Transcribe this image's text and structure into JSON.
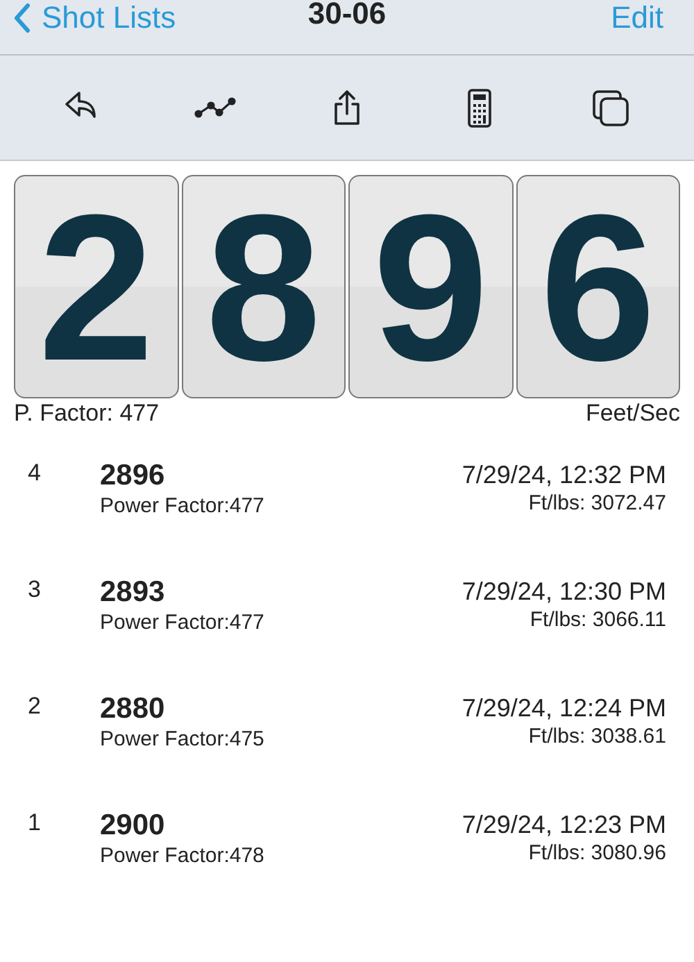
{
  "nav": {
    "back": "Shot Lists",
    "title": "30-06",
    "action": "Edit"
  },
  "toolbar": [
    {
      "kind": "reply"
    },
    {
      "kind": "chart"
    },
    {
      "kind": "share"
    },
    {
      "kind": "calculator"
    },
    {
      "kind": "copy"
    }
  ],
  "display": {
    "digits": [
      "2",
      "8",
      "9",
      "6"
    ],
    "left_label": "P. Factor: 477",
    "right_label": "Feet/Sec"
  },
  "shots": [
    {
      "number": "4",
      "velocity": "2896",
      "power_factor": "Power Factor:477",
      "time": "7/29/24, 12:32 PM",
      "energy": "Ft/lbs: 3072.47"
    },
    {
      "number": "3",
      "velocity": "2893",
      "power_factor": "Power Factor:477",
      "time": "7/29/24, 12:30 PM",
      "energy": "Ft/lbs: 3066.11"
    },
    {
      "number": "2",
      "velocity": "2880",
      "power_factor": "Power Factor:475",
      "time": "7/29/24, 12:24 PM",
      "energy": "Ft/lbs: 3038.61"
    },
    {
      "number": "1",
      "velocity": "2900",
      "power_factor": "Power Factor:478",
      "time": "7/29/24, 12:23 PM",
      "energy": "Ft/lbs: 3080.96"
    }
  ]
}
